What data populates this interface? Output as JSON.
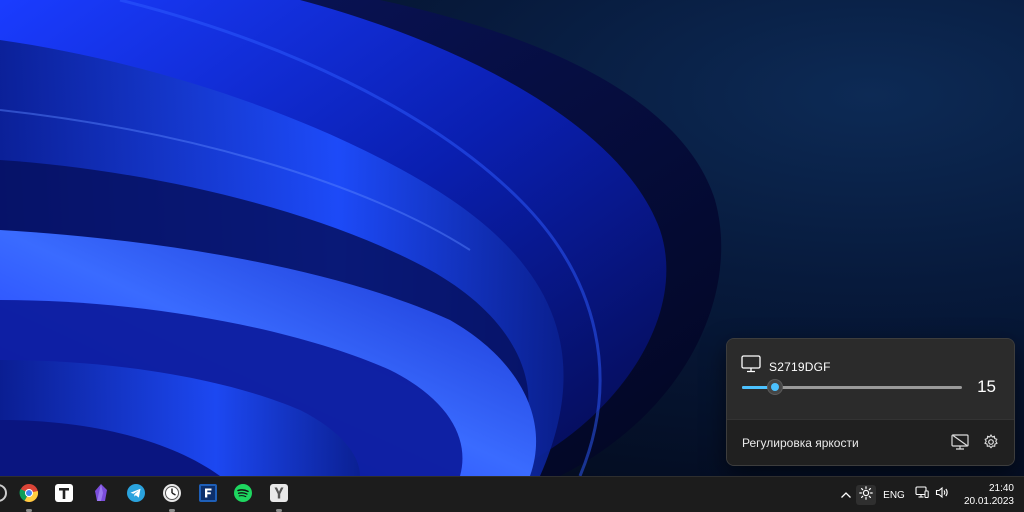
{
  "flyout": {
    "monitor_name": "S2719DGF",
    "brightness_value": "15",
    "brightness_level": 0.15,
    "footer_label": "Регулировка яркости",
    "icons": [
      "monitor-icon",
      "display-off-icon",
      "gear-icon"
    ]
  },
  "taskbar": {
    "apps": [
      "app-icon-partial",
      "chrome-icon",
      "typora-icon",
      "obsidian-icon",
      "telegram-icon",
      "clock-app-icon",
      "far-manager-icon",
      "spotify-icon",
      "yandex-browser-icon"
    ],
    "tray": {
      "overflow_icon": "chevron-up-icon",
      "brightness_icon": "sun-icon",
      "language": "ENG",
      "network_icon": "network-icon",
      "volume_icon": "speaker-icon"
    },
    "clock": {
      "time": "21:40",
      "date": "20.01.2023"
    }
  },
  "colors": {
    "accent": "#4cc2ff",
    "flyout_bg": "#2b2b2b",
    "taskbar_bg": "#1c1c1c"
  }
}
